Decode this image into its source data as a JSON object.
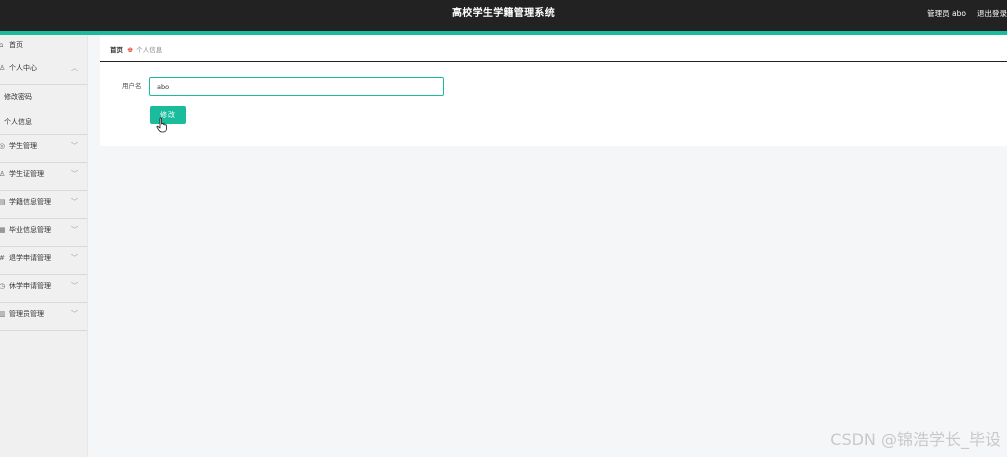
{
  "header": {
    "title": "高校学生学籍管理系统",
    "user_label": "管理员 abo",
    "logout_label": "退出登录"
  },
  "colors": {
    "header_bg": "#222222",
    "accent": "#1abc9c"
  },
  "sidebar": {
    "items": [
      {
        "label": "首页",
        "icon": "home-icon"
      },
      {
        "label": "个人中心",
        "icon": "user-icon",
        "expanded": true
      },
      {
        "label": "修改密码",
        "sub": true
      },
      {
        "label": "个人信息",
        "sub": true
      },
      {
        "label": "学生管理",
        "icon": "student-icon"
      },
      {
        "label": "学生证管理",
        "icon": "card-icon"
      },
      {
        "label": "学籍信息管理",
        "icon": "file-icon"
      },
      {
        "label": "毕业信息管理",
        "icon": "grad-icon"
      },
      {
        "label": "退学申请管理",
        "icon": "hash-icon"
      },
      {
        "label": "休学申请管理",
        "icon": "clock-icon"
      },
      {
        "label": "管理员管理",
        "icon": "admin-icon"
      }
    ]
  },
  "breadcrumb": {
    "home": "首页",
    "current": "个人信息"
  },
  "form": {
    "username_label": "用户名",
    "username_value": "abo",
    "submit_label": "修改"
  },
  "watermark": "CSDN @锦浩学长_毕设"
}
